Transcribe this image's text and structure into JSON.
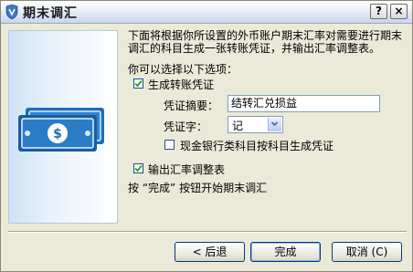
{
  "window": {
    "title": "期末调汇",
    "help_label": "?",
    "close_label": "×"
  },
  "intro": {
    "text": "下面将根据你所设置的外币账户期末汇率对需要进行期末调汇的科目生成一张转账凭证，并输出汇率调整表。",
    "choose_text": "你可以选择以下选项："
  },
  "options": {
    "generate_voucher": {
      "label": "生成转账凭证",
      "checked": true
    },
    "summary_label": "凭证摘要：",
    "summary_value": "结转汇兑损益",
    "word_label": "凭证字：",
    "word_value": "记",
    "cash_bank": {
      "label": "现金银行类科目按科目生成凭证",
      "checked": false
    },
    "output_table": {
      "label": "输出汇率调整表",
      "checked": true
    },
    "finish_hint": "按 “完成” 按钮开始期末调汇"
  },
  "buttons": {
    "back": "< 后退",
    "finish": "完成",
    "cancel": "取消 (C)"
  },
  "colors": {
    "titlebar": "#c8d5ea",
    "window_bg": "#ebe9d8",
    "banner_blue": "#1e6fb8",
    "check": "#21a121"
  }
}
